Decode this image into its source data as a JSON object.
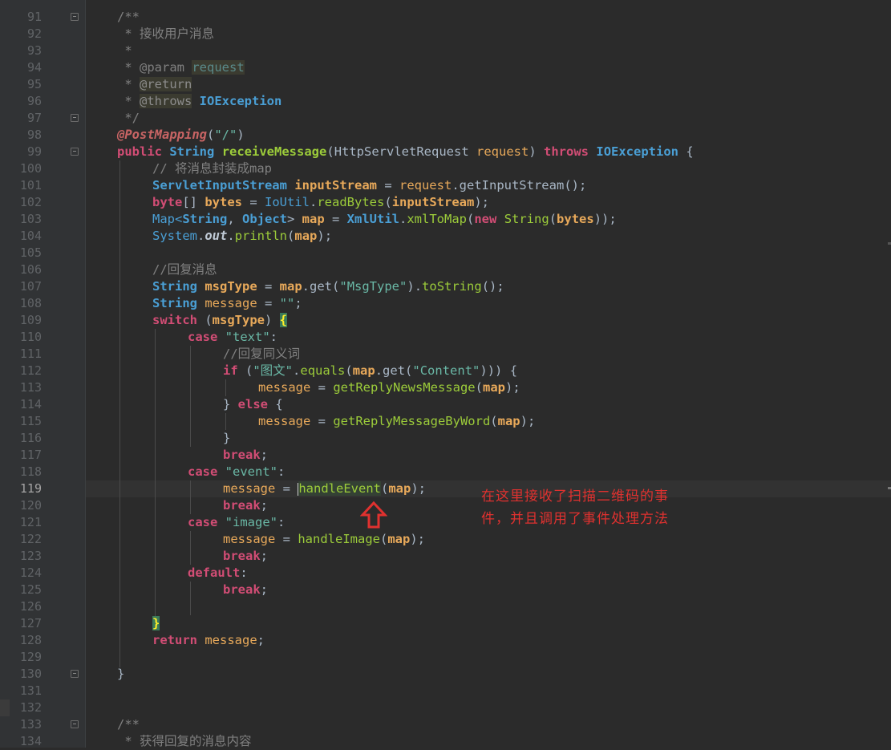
{
  "editor": {
    "line_numbers": [
      "91",
      "92",
      "93",
      "94",
      "95",
      "96",
      "97",
      "98",
      "99",
      "100",
      "101",
      "102",
      "103",
      "104",
      "105",
      "106",
      "107",
      "108",
      "109",
      "110",
      "111",
      "112",
      "113",
      "114",
      "115",
      "116",
      "117",
      "118",
      "119",
      "120",
      "121",
      "122",
      "123",
      "124",
      "125",
      "126",
      "127",
      "128",
      "129",
      "130",
      "131",
      "132",
      "133",
      "134"
    ],
    "current_line": "119",
    "top_partial_line": "90"
  },
  "code": {
    "l91": "/**",
    "l92": " * 接收用户消息",
    "l93": " *",
    "l94_a": " * @param ",
    "l94_b": "request",
    "l95_a": " * ",
    "l95_b": "@return",
    "l96_a": " * ",
    "l96_b": "@throws",
    "l96_c": "IOException",
    "l97": " */",
    "l98_a": "@PostMapping",
    "l98_b": "(",
    "l98_c": "\"/\"",
    "l98_d": ")",
    "l99_a": "public",
    "l99_b": "String",
    "l99_c": "receiveMessage",
    "l99_d": "HttpServletRequest",
    "l99_e": "request",
    "l99_f": "throws",
    "l99_g": "IOException",
    "l99_h": "{",
    "l100": "// 将消息封装成map",
    "l101_a": "ServletInputStream",
    "l101_b": "inputStream",
    "l101_c": "request",
    "l101_d": "getInputStream",
    "l102_a": "byte",
    "l102_b": "bytes",
    "l102_c": "IoUtil",
    "l102_d": "readBytes",
    "l102_e": "inputStream",
    "l103_a": "Map<",
    "l103_b": "String",
    "l103_c": "Object",
    "l103_d": "map",
    "l103_e": "XmlUtil",
    "l103_f": "xmlToMap",
    "l103_g": "new",
    "l103_h": "String",
    "l103_i": "bytes",
    "l104_a": "System",
    "l104_b": "out",
    "l104_c": "println",
    "l104_d": "map",
    "l106": "//回复消息",
    "l107_a": "String",
    "l107_b": "msgType",
    "l107_c": "map",
    "l107_d": "get",
    "l107_e": "\"MsgType\"",
    "l107_f": "toString",
    "l108_a": "String",
    "l108_b": "message",
    "l108_c": "\"\"",
    "l109_a": "switch",
    "l109_b": "msgType",
    "l109_c": "{",
    "l110_a": "case",
    "l110_b": "\"text\"",
    "l111": "//回复同义词",
    "l112_a": "if",
    "l112_b": "\"图文\"",
    "l112_c": "equals",
    "l112_d": "map",
    "l112_e": "get",
    "l112_f": "\"Content\"",
    "l113_a": "message",
    "l113_b": "getReplyNewsMessage",
    "l113_c": "map",
    "l114_a": "else",
    "l115_a": "message",
    "l115_b": "getReplyMessageByWord",
    "l115_c": "map",
    "l117": "break",
    "l118_a": "case",
    "l118_b": "\"event\"",
    "l119_a": "message",
    "l119_b": "handleEvent",
    "l119_c": "map",
    "l120": "break",
    "l121_a": "case",
    "l121_b": "\"image\"",
    "l122_a": "message",
    "l122_b": "handleImage",
    "l122_c": "map",
    "l123": "break",
    "l124": "default",
    "l125": "break",
    "l127": "}",
    "l128_a": "return",
    "l128_b": "message",
    "l130": "}",
    "l133": "/**",
    "l134": " * 获得回复的消息内容"
  },
  "annotation": {
    "line1": "在这里接收了扫描二维码的事",
    "line2": "件，并且调用了事件处理方法",
    "color": "#e0312f",
    "icon": "up-arrow-icon"
  }
}
